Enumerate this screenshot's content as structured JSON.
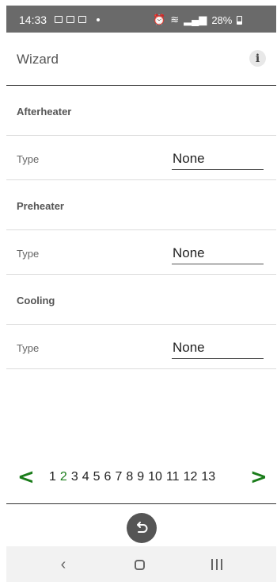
{
  "status_bar": {
    "time": "14:33",
    "battery": "28%"
  },
  "header": {
    "title": "Wizard"
  },
  "sections": [
    {
      "title": "Afterheater",
      "field_label": "Type",
      "value": "None"
    },
    {
      "title": "Preheater",
      "field_label": "Type",
      "value": "None"
    },
    {
      "title": "Cooling",
      "field_label": "Type",
      "value": "None"
    }
  ],
  "pager": {
    "prev": "<",
    "next": ">",
    "pages": [
      "1",
      "2",
      "3",
      "4",
      "5",
      "6",
      "7",
      "8",
      "9",
      "10",
      "11",
      "12",
      "13"
    ],
    "current": "2"
  },
  "colors": {
    "accent": "#1a7c1a",
    "status_bar": "#6a6a6a",
    "divider": "#333333"
  },
  "icons": {
    "info": "info-icon",
    "back": "undo-arrow-icon",
    "nav_back": "chevron-left-icon",
    "nav_home": "home-icon",
    "nav_recent": "recent-apps-icon"
  }
}
